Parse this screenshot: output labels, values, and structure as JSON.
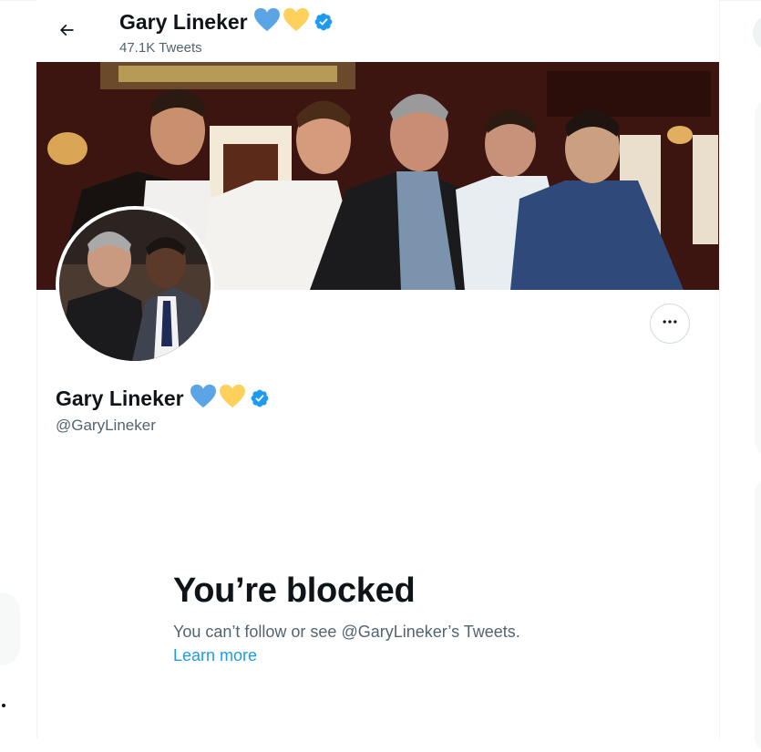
{
  "header": {
    "name": "Gary Lineker",
    "tweet_count": "47.1K Tweets",
    "back_icon": "arrow-left-icon"
  },
  "profile": {
    "name": "Gary Lineker",
    "handle": "@GaryLineker",
    "badges": [
      "blue-heart-icon",
      "yellow-heart-icon",
      "verified-badge-icon"
    ]
  },
  "actions": {
    "more_icon": "ellipsis-icon"
  },
  "blocked": {
    "title": "You’re blocked",
    "message": "You can’t follow or see @GaryLineker’s Tweets.",
    "learn_more": "Learn more"
  },
  "colors": {
    "accent": "#1d9bf0",
    "text_primary": "#0f1419",
    "text_secondary": "#536471",
    "heart_blue": "#5ba4e6",
    "heart_yellow": "#fdd15c"
  }
}
